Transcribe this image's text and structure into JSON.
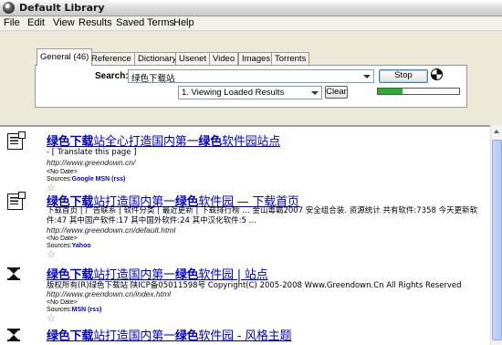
{
  "window": {
    "title": "Default Library"
  },
  "menu": [
    {
      "label": "File",
      "key": "F"
    },
    {
      "label": "Edit",
      "key": "E"
    },
    {
      "label": "View",
      "key": "V"
    },
    {
      "label": "Results",
      "key": "R"
    },
    {
      "label": "Saved Terms",
      "key": "S"
    },
    {
      "label": "Help",
      "key": "H"
    }
  ],
  "tabs": [
    {
      "label": "General (46)",
      "active": true
    },
    {
      "label": "Reference"
    },
    {
      "label": "Dictionary"
    },
    {
      "label": "Usenet"
    },
    {
      "label": "Video"
    },
    {
      "label": "Images"
    },
    {
      "label": "Torrents"
    }
  ],
  "search": {
    "label": "Search:",
    "value": "绿色下载站",
    "stop_label": "Stop",
    "view_select": "1. Viewing Loaded Results",
    "clear_label": "Clear",
    "progress": 0.3
  },
  "results": [
    {
      "icon": "document-icon",
      "title_hl": "绿色下载",
      "title_rest": "站全心打造国内第一",
      "title_hl2": "绿色",
      "title_rest2": "软件园站点",
      "snippet": "- [ Translate this page ]",
      "url": "http://www.greendown.cn/",
      "date": "<No Date>",
      "sources_label": "Sources:",
      "sources": "Google   MSN (rss)"
    },
    {
      "icon": "document-icon",
      "title_hl": "绿色下载",
      "title_rest": "站打造国内第一",
      "title_hl2": "绿色",
      "title_rest2": "软件园 — 下载首页",
      "snippet": "下载首页 | 广告联系 | 软件分类 | 最近更新 | 下载排行榜 … 金山毒霸2007 安全组合装. 资源统计 共有软件:7358 今天更新软件:47 其中国产软件:17 其中国外软件:24 其中汉化软件:5 …",
      "url": "http://www.greendown.cn/default.html",
      "date": "<No Date>",
      "sources_label": "Sources:",
      "sources": "Yahoo"
    },
    {
      "icon": "hourglass-icon",
      "title_hl": "绿色下载",
      "title_rest": "站打造国内第一",
      "title_hl2": "绿色",
      "title_rest2": "软件园 | 站点",
      "snippet": "版权所有(R)绿色下载站 陕ICP备05011598号 Copyright(C) 2005-2008 Www.Greendown.Cn All Rights Reserved",
      "url": "http://www.greendown.cn/index.html",
      "date": "<No Date>",
      "sources_label": "Sources:",
      "sources": "MSN (rss)"
    },
    {
      "icon": "hourglass-icon",
      "title_hl": "绿色下载",
      "title_rest": "站打造国内第一",
      "title_hl2": "绿色",
      "title_rest2": "软件园 - 风格主题",
      "snippet": "",
      "url": "",
      "date": "",
      "sources_label": "",
      "sources": ""
    }
  ]
}
